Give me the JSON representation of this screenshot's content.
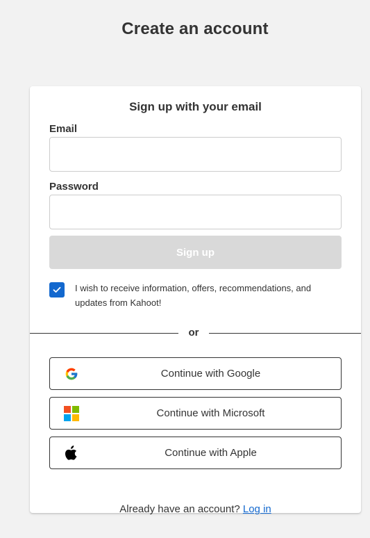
{
  "page": {
    "title": "Create an account"
  },
  "form": {
    "heading": "Sign up with your email",
    "email_label": "Email",
    "email_value": "",
    "password_label": "Password",
    "password_value": "",
    "signup_label": "Sign up",
    "consent_text": "I wish to receive information, offers, recommendations, and updates from Kahoot!",
    "consent_checked": true
  },
  "divider": {
    "text": "or"
  },
  "social": [
    {
      "label": "Continue with Google",
      "icon": "google-icon"
    },
    {
      "label": "Continue with Microsoft",
      "icon": "microsoft-icon"
    },
    {
      "label": "Continue with Apple",
      "icon": "apple-icon"
    }
  ],
  "footer": {
    "prompt": "Already have an account?",
    "login_label": "Log in"
  },
  "colors": {
    "background": "#f2f2f2",
    "accent": "#1368ce",
    "disabled_button": "#d9d9d9",
    "text": "#333333"
  }
}
